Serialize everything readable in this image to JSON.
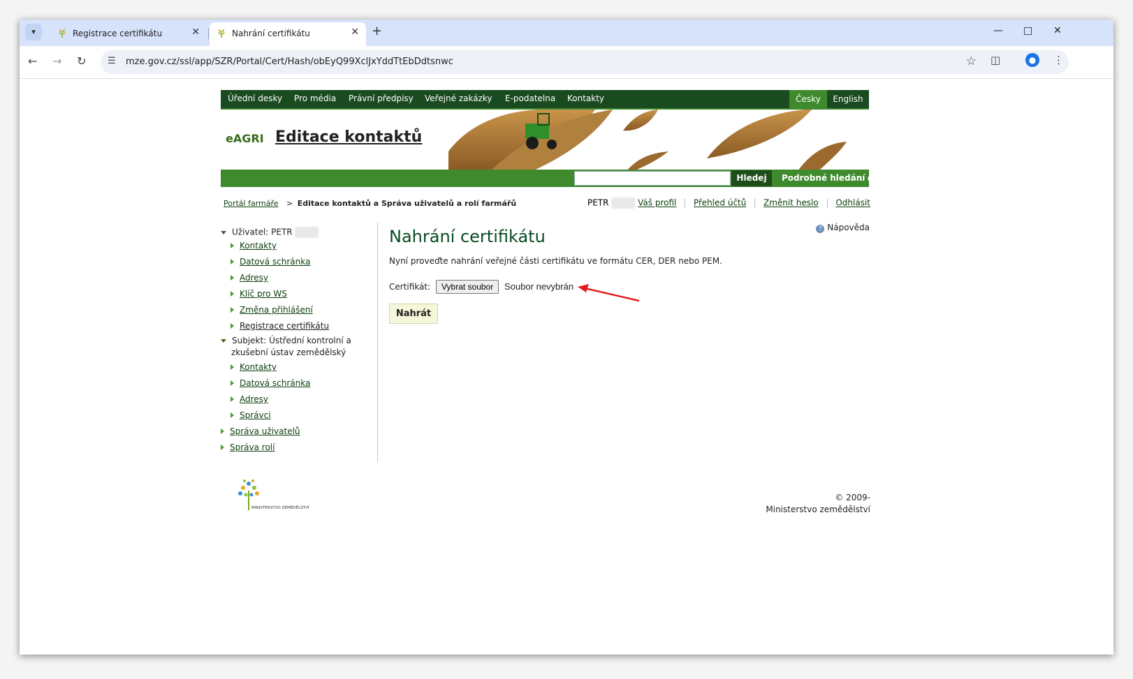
{
  "browser": {
    "tabs": [
      {
        "title": "Registrace certifikátu",
        "active": false
      },
      {
        "title": "Nahrání certifikátu",
        "active": true
      }
    ],
    "url": "mze.gov.cz/ssl/app/SZR/Portal/Cert/Hash/obEyQ99XclJxYddTtEbDdtsnwc",
    "icons": {
      "tab_menu": "chevron-down-icon",
      "new_tab": "plus-icon",
      "back": "arrow-left-icon",
      "forward": "arrow-right-icon",
      "reload": "reload-icon",
      "site_info": "tune-icon",
      "bookmark": "star-icon",
      "extensions": "puzzle-icon",
      "profile": "person-icon",
      "more": "kebab-menu-icon"
    }
  },
  "topnav": {
    "items": [
      "Úřední desky",
      "Pro média",
      "Právní předpisy",
      "Veřejné zakázky",
      "E-podatelna",
      "Kontakty"
    ],
    "lang_cs": "Česky",
    "lang_en": "English"
  },
  "banner": {
    "logo": "eAGRI",
    "title": "Editace kontaktů"
  },
  "search": {
    "value": "",
    "button": "Hledej",
    "advanced": "Podrobné hledání"
  },
  "breadcrumb": {
    "root": "Portál farmáře",
    "separator": ">",
    "current": "Editace kontaktů a Správa uživatelů a rolí farmářů"
  },
  "userbar": {
    "name": "PETR",
    "links": [
      "Váš profil",
      "Přehled účtů",
      "Změnit heslo",
      "Odhlásit"
    ]
  },
  "leftmenu": {
    "user_label": "Uživatel: PETR",
    "user_items": [
      "Kontakty",
      "Datová schránka",
      "Adresy",
      "Klíč pro WS",
      "Změna přihlášení",
      "Registrace certifikátu"
    ],
    "subject_label_1": "Subjekt: Ústřední kontrolní a",
    "subject_label_2": "zkušební ústav zemědělský",
    "subject_items": [
      "Kontakty",
      "Datová schránka",
      "Adresy",
      "Správci"
    ],
    "admin_items": [
      "Správa uživatelů",
      "Správa rolí"
    ]
  },
  "main": {
    "help": "Nápověda",
    "title": "Nahrání certifikátu",
    "instruction": "Nyní proveďte nahrání veřejné části certifikátu ve formátu CER, DER nebo PEM.",
    "cert_label": "Certifikát:",
    "file_button": "Vybrat soubor",
    "file_status": "Soubor nevybrán",
    "upload_button": "Nahrát"
  },
  "footer": {
    "logo_text": "MINISTERSTVO ZEMĚDĚLSTVÍ",
    "copyright": "© 2009-",
    "org": "Ministerstvo zemědělství"
  },
  "colors": {
    "nav_dark": "#1a4a1f",
    "nav_green": "#3e8a2d",
    "title_green": "#0a4a22",
    "annotation_arrow": "#e11d1d"
  }
}
